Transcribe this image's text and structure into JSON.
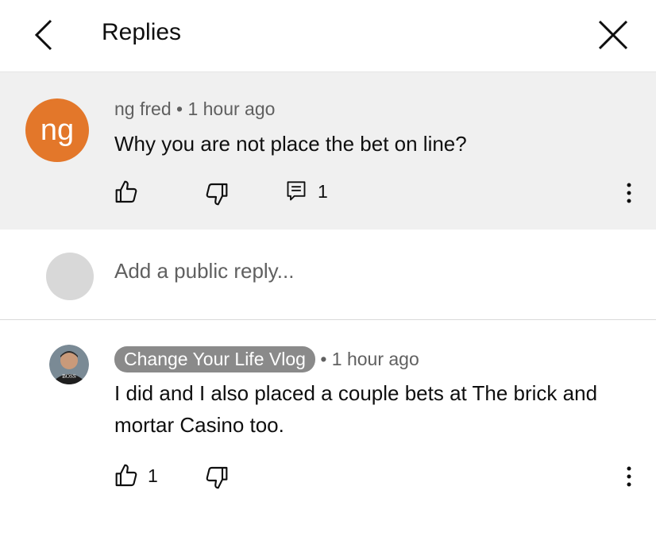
{
  "header": {
    "title": "Replies",
    "back_icon": "chevron-left-icon",
    "close_icon": "close-icon"
  },
  "parent_comment": {
    "avatar_initials": "ng",
    "avatar_color": "#e3772a",
    "author": "ng fred",
    "separator": "•",
    "time": "1 hour ago",
    "text": "Why you are not place the bet on line?",
    "reply_count": "1"
  },
  "reply_box": {
    "placeholder": "Add a public reply..."
  },
  "reply": {
    "author": "Change Your Life Vlog",
    "author_chip_color": "#8a8a8a",
    "avatar_text": "BOSS",
    "separator": "•",
    "time": "1 hour ago",
    "text": "I did and I also placed a couple bets at The brick and mortar Casino too.",
    "like_count": "1"
  },
  "colors": {
    "parent_background": "#f0f0f0",
    "secondary_text": "#606060"
  }
}
